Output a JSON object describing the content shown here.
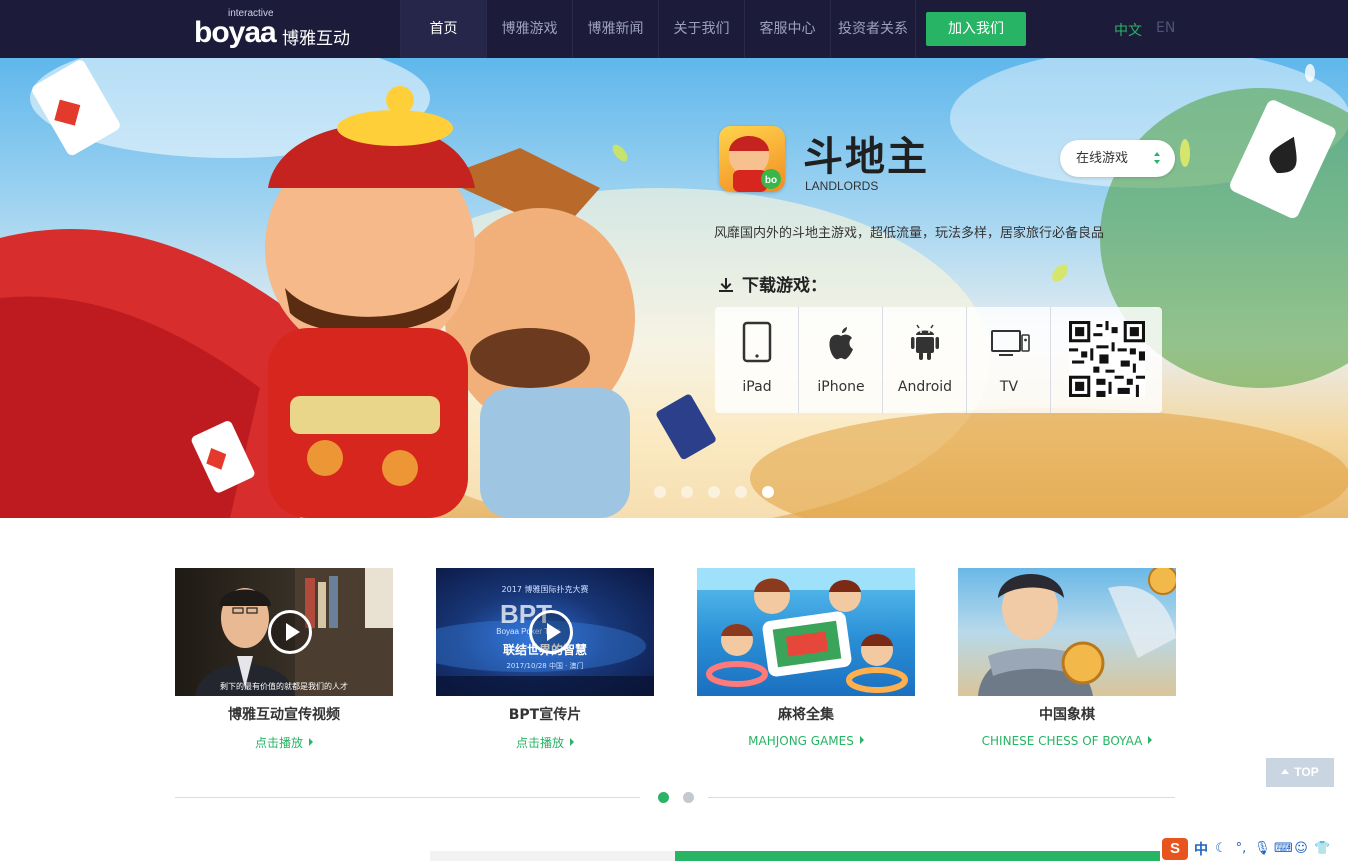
{
  "header": {
    "logo_small": "interactive",
    "logo_main": "boyaa",
    "logo_cn": "博雅互动",
    "nav": [
      {
        "label": "首页",
        "active": true
      },
      {
        "label": "博雅游戏",
        "active": false
      },
      {
        "label": "博雅新闻",
        "active": false
      },
      {
        "label": "关于我们",
        "active": false
      },
      {
        "label": "客服中心",
        "active": false
      },
      {
        "label": "投资者关系",
        "active": false
      }
    ],
    "join_label": "加入我们",
    "lang_cn": "中文",
    "lang_en": "EN"
  },
  "banner": {
    "game_title": "斗地主",
    "game_subtitle": "LANDLORDS",
    "select_value": "在线游戏",
    "description": "风靡国内外的斗地主游戏，超低流量，玩法多样，居家旅行必备良品",
    "download_title": "下载游戏：",
    "platforms": [
      "iPad",
      "iPhone",
      "Android",
      "TV"
    ],
    "slide_count": 5,
    "active_slide": 5
  },
  "cards": [
    {
      "title": "博雅互动宣传视频",
      "link": "点击播放",
      "video": true
    },
    {
      "title": "BPT宣传片",
      "link": "点击播放",
      "video": true
    },
    {
      "title": "麻将全集",
      "link": "MAHJONG GAMES",
      "video": false
    },
    {
      "title": "中国象棋",
      "link": "CHINESE CHESS OF BOYAA",
      "video": false
    }
  ],
  "thumb_text": {
    "card1_caption": "剩下的最有价值的就都是我们的人才",
    "card2_year": "2017 博雅国际扑克大赛",
    "card2_logo": "BPT",
    "card2_tour": "Boyaa Poker Tour",
    "card2_slogan": "联结世界的智慧",
    "card2_date": "2017/10/28  中国 · 澳门"
  },
  "pager": {
    "count": 2,
    "active": 1
  },
  "top_button": "TOP",
  "ime": {
    "logo": "S",
    "lang": "中"
  },
  "colors": {
    "brand_green": "#27b464",
    "header_bg": "#1c1c3a"
  }
}
